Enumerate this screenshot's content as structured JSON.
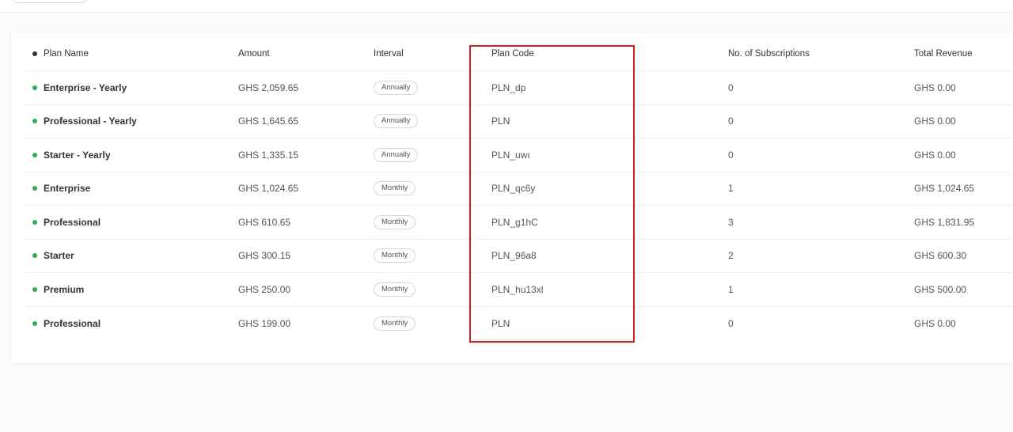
{
  "colors": {
    "active_dot": "#2eaa5c",
    "header_dot": "#333333",
    "highlight": "#d21f26"
  },
  "table": {
    "headers": {
      "plan_name": "Plan Name",
      "amount": "Amount",
      "interval": "Interval",
      "plan_code": "Plan Code",
      "subscriptions": "No. of Subscriptions",
      "revenue": "Total Revenue"
    },
    "rows": [
      {
        "name": "Enterprise - Yearly",
        "amount": "GHS 2,059.65",
        "interval": "Annually",
        "code": "PLN_dp",
        "subs": "0",
        "revenue": "GHS 0.00"
      },
      {
        "name": "Professional - Yearly",
        "amount": "GHS 1,645.65",
        "interval": "Annually",
        "code": "PLN",
        "subs": "0",
        "revenue": "GHS 0.00"
      },
      {
        "name": "Starter - Yearly",
        "amount": "GHS 1,335.15",
        "interval": "Annually",
        "code": "PLN_uwı",
        "subs": "0",
        "revenue": "GHS 0.00"
      },
      {
        "name": "Enterprise",
        "amount": "GHS 1,024.65",
        "interval": "Monthly",
        "code": "PLN_qc6y",
        "subs": "1",
        "revenue": "GHS 1,024.65"
      },
      {
        "name": "Professional",
        "amount": "GHS 610.65",
        "interval": "Monthly",
        "code": "PLN_g1hC",
        "subs": "3",
        "revenue": "GHS 1,831.95"
      },
      {
        "name": "Starter",
        "amount": "GHS 300.15",
        "interval": "Monthly",
        "code": "PLN_96a8",
        "subs": "2",
        "revenue": "GHS 600.30"
      },
      {
        "name": "Premium",
        "amount": "GHS 250.00",
        "interval": "Monthly",
        "code": "PLN_hu13xl",
        "subs": "1",
        "revenue": "GHS 500.00"
      },
      {
        "name": "Professional",
        "amount": "GHS 199.00",
        "interval": "Monthly",
        "code": "PLN",
        "subs": "0",
        "revenue": "GHS 0.00"
      }
    ]
  }
}
